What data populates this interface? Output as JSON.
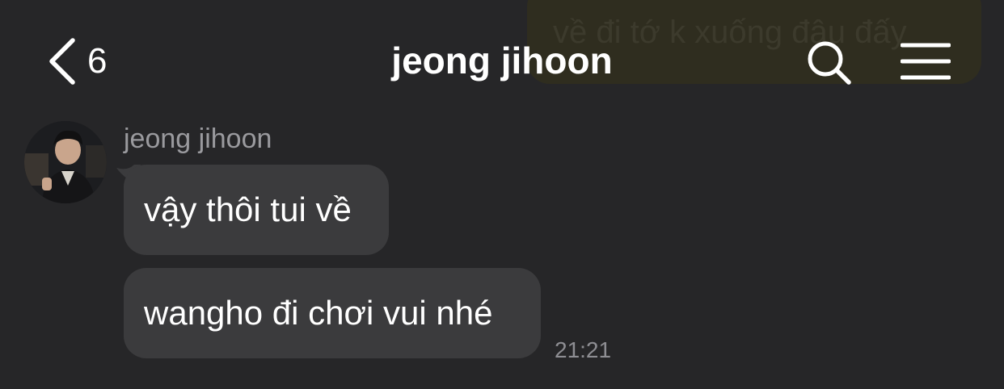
{
  "header": {
    "back_count": "6",
    "title": "jeong jihoon"
  },
  "background_message": {
    "text": "về đi tớ k xuống đâu đấy"
  },
  "conversation": {
    "sender_name": "jeong jihoon",
    "messages": [
      {
        "text": "vậy thôi tui về"
      },
      {
        "text": "wangho đi chơi vui nhé"
      }
    ],
    "timestamp": "21:21"
  },
  "icons": {
    "back": "chevron-left-icon",
    "search": "search-icon",
    "menu": "hamburger-menu-icon"
  },
  "colors": {
    "background": "#262628",
    "incoming_bubble": "#3b3b3d",
    "outgoing_bubble": "#2f2d1f",
    "text": "#ffffff",
    "muted_text": "#9a9a9e"
  }
}
